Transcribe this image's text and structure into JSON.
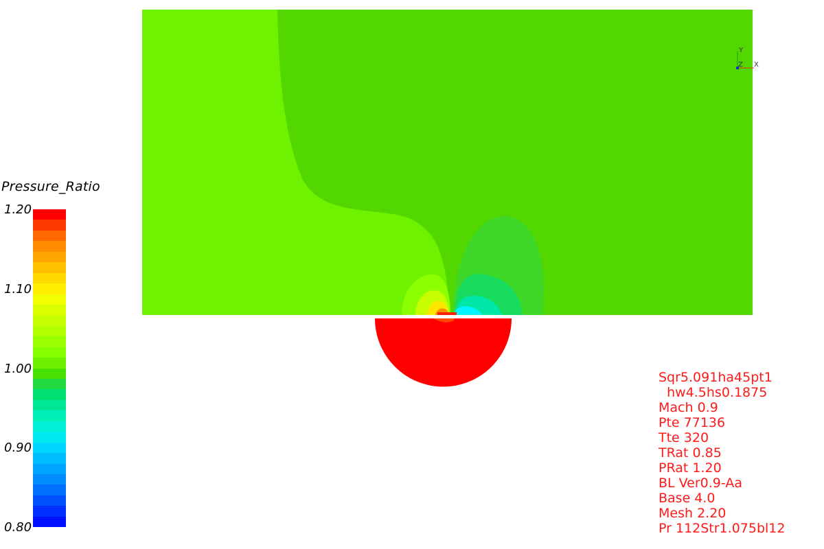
{
  "legend": {
    "title": "Pressure_Ratio",
    "ticks": [
      "1.20",
      "1.10",
      "1.00",
      "0.90",
      "0.80"
    ],
    "range": [
      0.8,
      1.2
    ],
    "bands": [
      "#ff0000",
      "#ff3a00",
      "#ff6a00",
      "#ff8c00",
      "#ffa600",
      "#ffc000",
      "#ffd800",
      "#ffee00",
      "#f2ff00",
      "#dcff00",
      "#c8ff00",
      "#b2ff00",
      "#9cff00",
      "#86ff00",
      "#6cf000",
      "#48e000",
      "#20d840",
      "#00e070",
      "#00e896",
      "#00f0b8",
      "#00f0d8",
      "#00e8f0",
      "#00d4ff",
      "#00bcff",
      "#00a4ff",
      "#008cff",
      "#0070ff",
      "#0050ff",
      "#0030ff",
      "#0010ff"
    ]
  },
  "axes": {
    "y": "Y",
    "z": "Z",
    "x": "X"
  },
  "field": {
    "background_color": "#52d800",
    "far_left_color": "#6ef200",
    "semicircle_color": "#ff0000"
  },
  "info": [
    "Sqr5.091ha45pt1",
    "  hw4.5hs0.1875",
    "Mach 0.9",
    "Pte 77136",
    "Tte 320",
    "TRat 0.85",
    "PRat 1.20",
    "BL Ver0.9-Aa",
    "Base 4.0",
    "Mesh 2.20",
    "Pr 112Str1.075bl12"
  ]
}
